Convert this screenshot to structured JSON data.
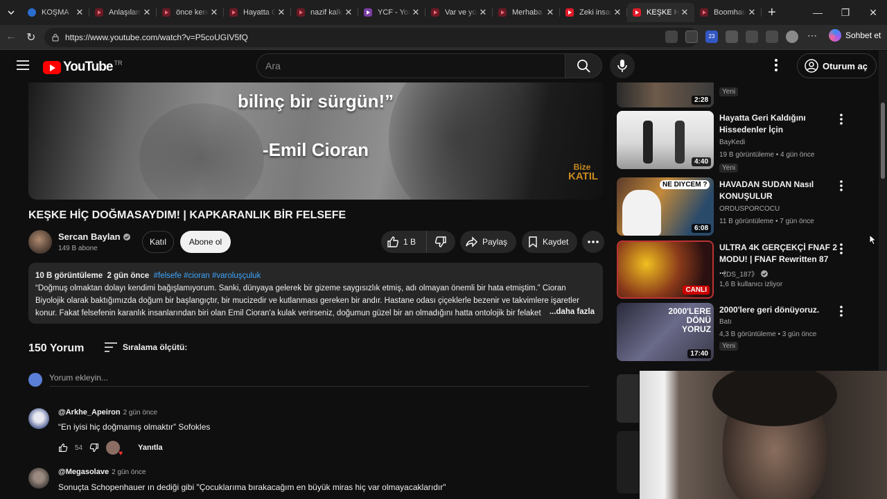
{
  "browser": {
    "tabs": [
      {
        "title": "KOŞMA",
        "fav": "star",
        "active": false
      },
      {
        "title": "Anlaşılamamak",
        "fav": "dark",
        "active": false
      },
      {
        "title": "önce kendini",
        "fav": "dark",
        "active": false
      },
      {
        "title": "Hayatta Geri",
        "fav": "dark",
        "active": false
      },
      {
        "title": "nazif kalk da",
        "fav": "dark",
        "active": false
      },
      {
        "title": "YCF - Youtube",
        "fav": "purple",
        "active": false
      },
      {
        "title": "Var ve yok",
        "fav": "dark",
        "active": false
      },
      {
        "title": "Merhaba -",
        "fav": "dark",
        "active": false
      },
      {
        "title": "Zeki insanlar",
        "fav": "red",
        "active": false
      },
      {
        "title": "KEŞKE HİÇ",
        "fav": "red",
        "active": true
      },
      {
        "title": "Boomhauer",
        "fav": "dark",
        "active": false
      }
    ],
    "url": "https://www.youtube.com/watch?v=P5coUGIV5fQ",
    "copilot_label": "Sohbet et",
    "extension_badge": "23"
  },
  "header": {
    "logo_text": "YouTube",
    "country_code": "TR",
    "search_placeholder": "Ara",
    "signin_label": "Oturum aç"
  },
  "video": {
    "quote_line": "bilinç bir sürgün!”",
    "quote_author": "-Emil Cioran",
    "watermark_line1": "Bize",
    "watermark_line2": "KATIL",
    "title": "KEŞKE HİÇ DOĞMASAYDIM! | KAPKARANLIK BİR FELSEFE",
    "channel_name": "Sercan Baylan",
    "channel_subs": "149 B abone",
    "join_label": "Katıl",
    "subscribe_label": "Abone ol",
    "likes": "1 B",
    "share_label": "Paylaş",
    "save_label": "Kaydet"
  },
  "description": {
    "views": "10 B görüntüleme",
    "age": "2 gün önce",
    "tags": "#felsefe #cioran #varoluşçuluk",
    "text": "“Doğmuş olmaktan dolayı kendimi bağışlamıyorum. Sanki, dünyaya gelerek bir gizeme saygısızlık etmiş, adı olmayan önemli bir hata etmiştim.” Cioran Biyolojik olarak baktığımızda doğum bir başlangıçtır, bir mucizedir ve kutlanması gereken bir andır. Hastane odası çiçeklerle bezenir ve takvimlere işaretler konur. Fakat felsefenin karanlık insanlarından biri olan Emil Cioran'a kulak verirseniz, doğumun güzel bir an olmadığını hatta ontolojik bir felaket",
    "more_label": "...daha fazla"
  },
  "comments": {
    "count_label": "150 Yorum",
    "sort_label": "Sıralama ölçütü:",
    "input_placeholder": "Yorum ekleyin...",
    "items": [
      {
        "author": "@Arkhe_Apeiron",
        "time": "2 gün önce",
        "text": "“En iyisi hiç doğmamış olmaktır” Sofokles",
        "likes": "54",
        "reply_label": "Yanıtla"
      },
      {
        "author": "@Megasolave",
        "time": "2 gün önce",
        "text": "Sonuçta Schopenhauer ın dediği gibi \"Çocuklarıma bırakacağım en büyük miras hiç var olmayacaklarıdır\""
      }
    ]
  },
  "recommendations": {
    "top_partial": {
      "duration": "2:28",
      "badge": "Yeni"
    },
    "items": [
      {
        "title": "Hayatta Geri Kaldığını Hissedenler İçin",
        "channel": "BayKedi",
        "meta": "19 B görüntüleme • 4 gün önce",
        "duration": "4:40",
        "badge": "Yeni",
        "verified": false,
        "live": false
      },
      {
        "title": "HAVADAN SUDAN Nasıl KONUŞULUR",
        "channel": "ORDUSPORCOCU",
        "meta": "11 B görüntüleme • 7 gün önce",
        "duration": "6:08",
        "badge": "",
        "verified": false,
        "live": false,
        "thumb_text": "NE DIYCEM ?"
      },
      {
        "title": "ULTRA 4K GERÇEKÇİ FNAF 2 MODU! | FNAF Rewritten 87 ...",
        "channel": "《DS_187》",
        "meta": "1,6 B kullanıcı izliyor",
        "duration": "CANLI",
        "badge": "",
        "verified": true,
        "live": true
      },
      {
        "title": "2000'lere geri dönüyoruz.",
        "channel": "Batı",
        "meta": "4,3 B görüntüleme • 3 gün önce",
        "duration": "17:40",
        "badge": "Yeni",
        "verified": false,
        "live": false,
        "thumb_text": "2000'LERE DÖNÜ YORUZ"
      }
    ]
  },
  "colors": {
    "background": "#0f0f0f",
    "brand_red": "#ff0000",
    "link_blue": "#3ea6ff",
    "chip_bg": "#272727"
  }
}
